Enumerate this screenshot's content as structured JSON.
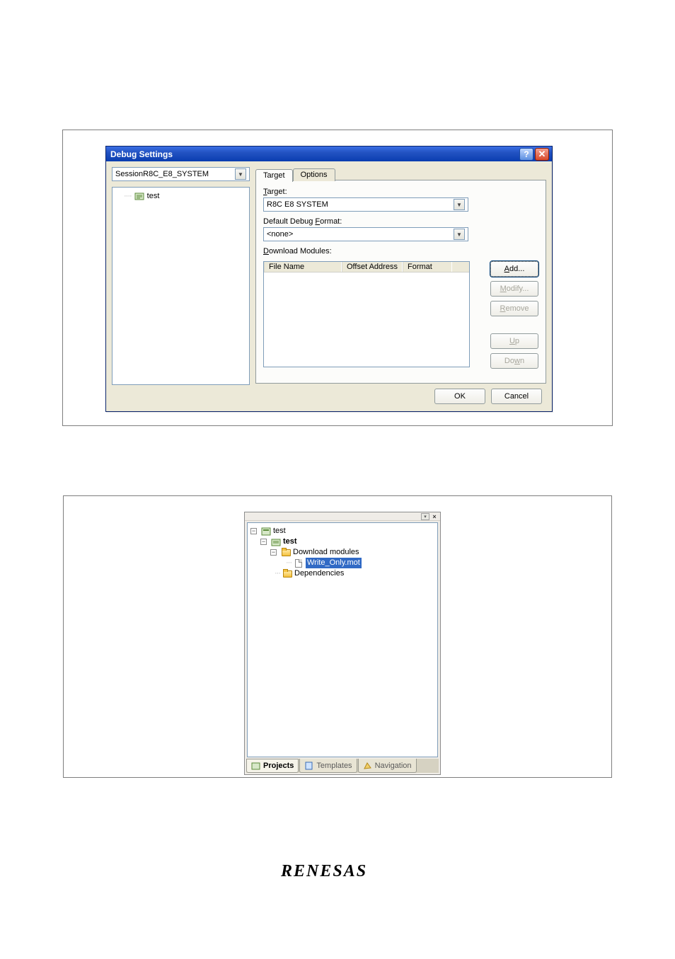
{
  "dialog": {
    "title": "Debug Settings",
    "sessionSelect": "SessionR8C_E8_SYSTEM",
    "treeRoot": "test",
    "tabs": {
      "target": "Target",
      "options": "Options"
    },
    "targetLabelPrefix": "T",
    "targetLabelRest": "arget:",
    "targetValue": "R8C E8 SYSTEM",
    "formatLabelPre": "Default Debug ",
    "formatLabelAccel": "F",
    "formatLabelPost": "ormat:",
    "formatValue": "<none>",
    "modulesLabelAccel": "D",
    "modulesLabelRest": "ownload Modules:",
    "cols": {
      "file": "File Name",
      "offset": "Offset Address",
      "format": "Format"
    },
    "buttons": {
      "addAccel": "A",
      "addRest": "dd...",
      "modifyAccel": "M",
      "modifyRest": "odify...",
      "removeAccel": "R",
      "removeRest": "emove",
      "upAccel": "U",
      "upRest": "p",
      "downRest": "Do",
      "downAccel": "w",
      "downPost": "n",
      "ok": "OK",
      "cancel": "Cancel"
    }
  },
  "workspace": {
    "root": "test",
    "project": "test",
    "downloads": "Download modules",
    "file": "Write_Only.mot",
    "deps": "Dependencies",
    "tabs": {
      "projects": "Projects",
      "templates": "Templates",
      "navigation": "Navigation"
    }
  },
  "logo": "RENESAS"
}
